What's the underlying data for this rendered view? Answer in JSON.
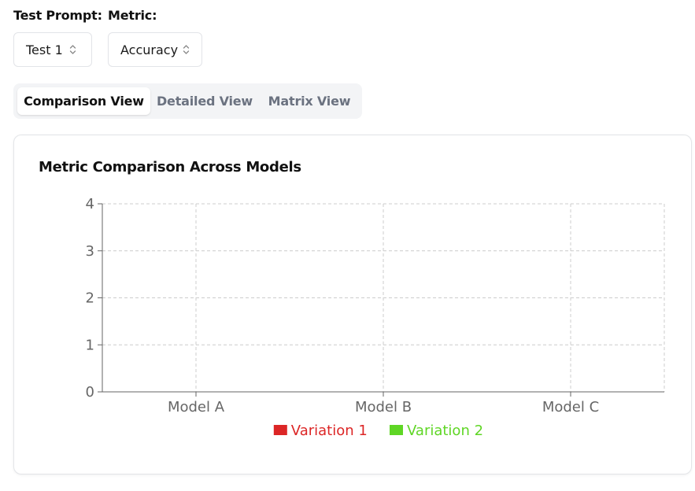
{
  "filters": {
    "test_prompt_label": "Test Prompt:",
    "test_prompt_value": "Test 1",
    "metric_label": "Metric:",
    "metric_value": "Accuracy"
  },
  "tabs": [
    {
      "label": "Comparison View",
      "active": true
    },
    {
      "label": "Detailed View",
      "active": false
    },
    {
      "label": "Matrix View",
      "active": false
    }
  ],
  "card": {
    "title": "Metric Comparison Across Models"
  },
  "chart_data": {
    "type": "bar",
    "title": "Metric Comparison Across Models",
    "categories": [
      "Model A",
      "Model B",
      "Model C"
    ],
    "series": [
      {
        "name": "Variation 1",
        "color": "#dc2626",
        "values": [
          0,
          0,
          0
        ]
      },
      {
        "name": "Variation 2",
        "color": "#5fd625",
        "values": [
          0,
          0,
          0
        ]
      }
    ],
    "ylim": [
      0,
      4
    ],
    "yticks": [
      0,
      1,
      2,
      3,
      4
    ],
    "grid": true,
    "legend": "bottom-center",
    "xlabel": "",
    "ylabel": ""
  }
}
